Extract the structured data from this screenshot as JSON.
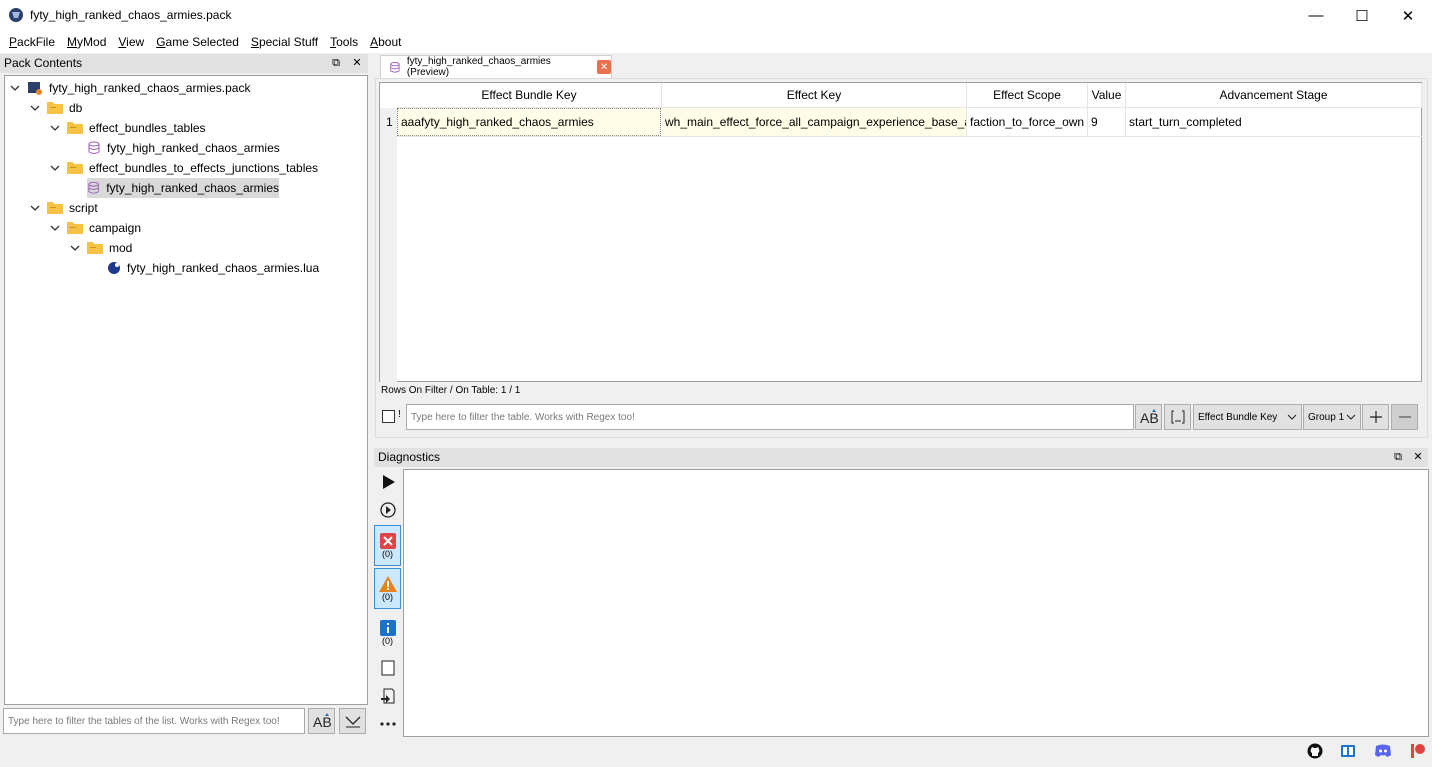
{
  "window": {
    "title": "fyty_high_ranked_chaos_armies.pack",
    "minimize": "—",
    "maximize": "☐",
    "close": "✕"
  },
  "menu": [
    "PackFile",
    "MyMod",
    "View",
    "Game Selected",
    "Special Stuff",
    "Tools",
    "About"
  ],
  "pack_contents": {
    "title": "Pack Contents",
    "tree": [
      {
        "label": "fyty_high_ranked_chaos_armies.pack",
        "type": "pack"
      },
      {
        "label": "db",
        "type": "folder"
      },
      {
        "label": "effect_bundles_tables",
        "type": "folder"
      },
      {
        "label": "fyty_high_ranked_chaos_armies",
        "type": "table"
      },
      {
        "label": "effect_bundles_to_effects_junctions_tables",
        "type": "folder"
      },
      {
        "label": "fyty_high_ranked_chaos_armies",
        "type": "table"
      },
      {
        "label": "script",
        "type": "folder"
      },
      {
        "label": "campaign",
        "type": "folder"
      },
      {
        "label": "mod",
        "type": "folder"
      },
      {
        "label": "fyty_high_ranked_chaos_armies.lua",
        "type": "lua"
      }
    ],
    "filter_placeholder": "Type here to filter the tables of the list. Works with Regex too!"
  },
  "tab": {
    "label": "fyty_high_ranked_chaos_armies (Preview)"
  },
  "table": {
    "columns": [
      "Effect Bundle Key",
      "Effect Key",
      "Effect Scope",
      "Value",
      "Advancement Stage"
    ],
    "rows": [
      {
        "index": "1",
        "cells": [
          "aaafyty_high_ranked_chaos_armies",
          "wh_main_effect_force_all_campaign_experience_base_all",
          "faction_to_force_own",
          "9",
          "start_turn_completed"
        ]
      }
    ],
    "rows_on_filter": "Rows On Filter / On Table: 1 / 1",
    "filter_placeholder": "Type here to filter the table. Works with Regex too!",
    "invert_label": "!",
    "column_select": "Effect Bundle Key",
    "group_select": "Group 1"
  },
  "diagnostics": {
    "title": "Diagnostics",
    "error_count": "(0)",
    "warning_count": "(0)",
    "info_count": "(0)"
  },
  "colors": {
    "accent": "#cce8ff",
    "error": "#e04343",
    "warning": "#e8841c",
    "info": "#1a73c9",
    "folder": "#f5c242",
    "selection": "#d9d9d9"
  }
}
